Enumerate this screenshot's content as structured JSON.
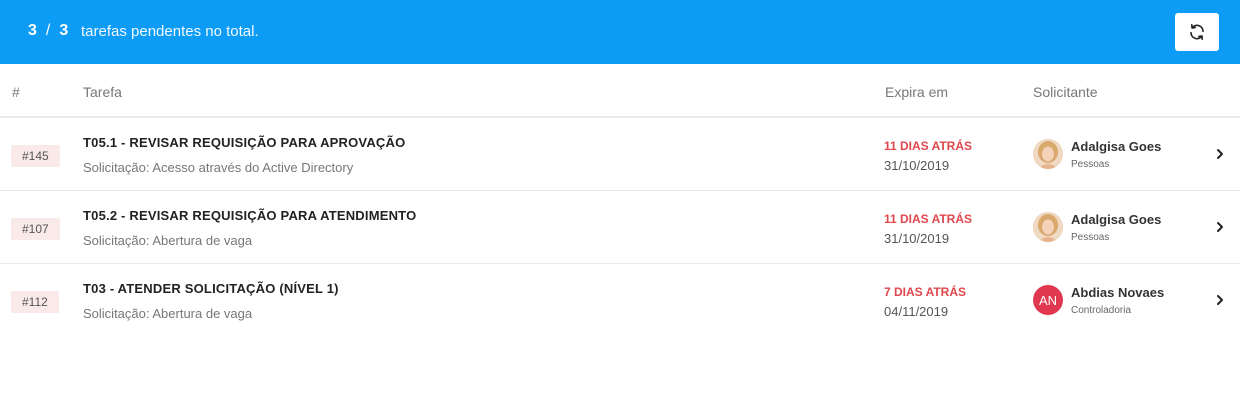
{
  "header": {
    "count_current": "3",
    "count_separator": "/",
    "count_total": "3",
    "count_label": "tarefas pendentes no total.",
    "refresh_icon": "refresh-icon",
    "background_color": "#0d9cf5"
  },
  "table": {
    "columns": {
      "number": "#",
      "task": "Tarefa",
      "expires": "Expira em",
      "requester": "Solicitante"
    },
    "rows": [
      {
        "id": "#145",
        "title": "T05.1 - REVISAR REQUISIÇÃO PARA APROVAÇÃO",
        "subtitle": "Solicitação: Acesso através do Active Directory",
        "expires_relative": "11 DIAS ATRÁS",
        "expires_date": "31/10/2019",
        "requester_name": "Adalgisa Goes",
        "requester_dept": "Pessoas",
        "avatar_type": "photo",
        "avatar_initials": ""
      },
      {
        "id": "#107",
        "title": "T05.2 - REVISAR REQUISIÇÃO PARA ATENDIMENTO",
        "subtitle": "Solicitação: Abertura de vaga",
        "expires_relative": "11 DIAS ATRÁS",
        "expires_date": "31/10/2019",
        "requester_name": "Adalgisa Goes",
        "requester_dept": "Pessoas",
        "avatar_type": "photo",
        "avatar_initials": ""
      },
      {
        "id": "#112",
        "title": "T03 - ATENDER SOLICITAÇÃO (NÍVEL 1)",
        "subtitle": "Solicitação: Abertura de vaga",
        "expires_relative": "7 DIAS ATRÁS",
        "expires_date": "04/11/2019",
        "requester_name": "Abdias Novaes",
        "requester_dept": "Controladoria",
        "avatar_type": "initials",
        "avatar_initials": "AN"
      }
    ]
  },
  "colors": {
    "overdue": "#e0474c",
    "badge_bg": "#f9e9e9",
    "initials_avatar": "#e0384f"
  }
}
